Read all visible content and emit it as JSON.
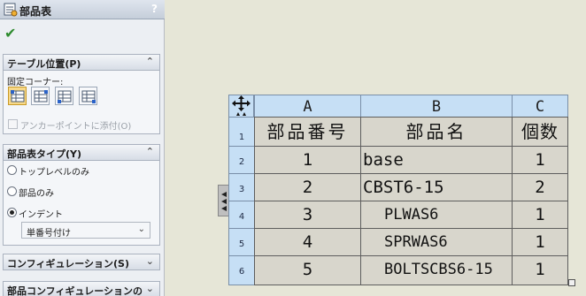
{
  "panel": {
    "title": "部品表",
    "help_label": "?",
    "table_position": {
      "header": "テーブル位置(P)",
      "anchor_label": "固定コーナー:",
      "attach_label": "アンカーポイントに添付(O)"
    },
    "bom_type": {
      "header": "部品表タイプ(Y)",
      "options": [
        "トップレベルのみ",
        "部品のみ",
        "インデント"
      ],
      "selected": "インデント",
      "numbering_value": "単番号付け"
    },
    "configurations_header": "コンフィギュレーション(S)",
    "part_configurations_header": "部品コンフィギュレーションの"
  },
  "bom": {
    "columns": [
      "A",
      "B",
      "C"
    ],
    "row_numbers": [
      "1",
      "2",
      "3",
      "4",
      "5",
      "6"
    ],
    "header_row": [
      "部品番号",
      "部品名",
      "個数"
    ],
    "rows": [
      [
        "1",
        "base",
        "1"
      ],
      [
        "2",
        "CBST6-15",
        "2"
      ],
      [
        "3",
        "PLWAS6",
        "1"
      ],
      [
        "4",
        "SPRWAS6",
        "1"
      ],
      [
        "5",
        "BOLTSCBS6-15",
        "1"
      ]
    ]
  },
  "colors": {
    "header_blue": "#c6dff5",
    "data_cell_gray": "#d8d6cc",
    "background": "#e6e6d7",
    "check_green": "#2e8b2e"
  }
}
